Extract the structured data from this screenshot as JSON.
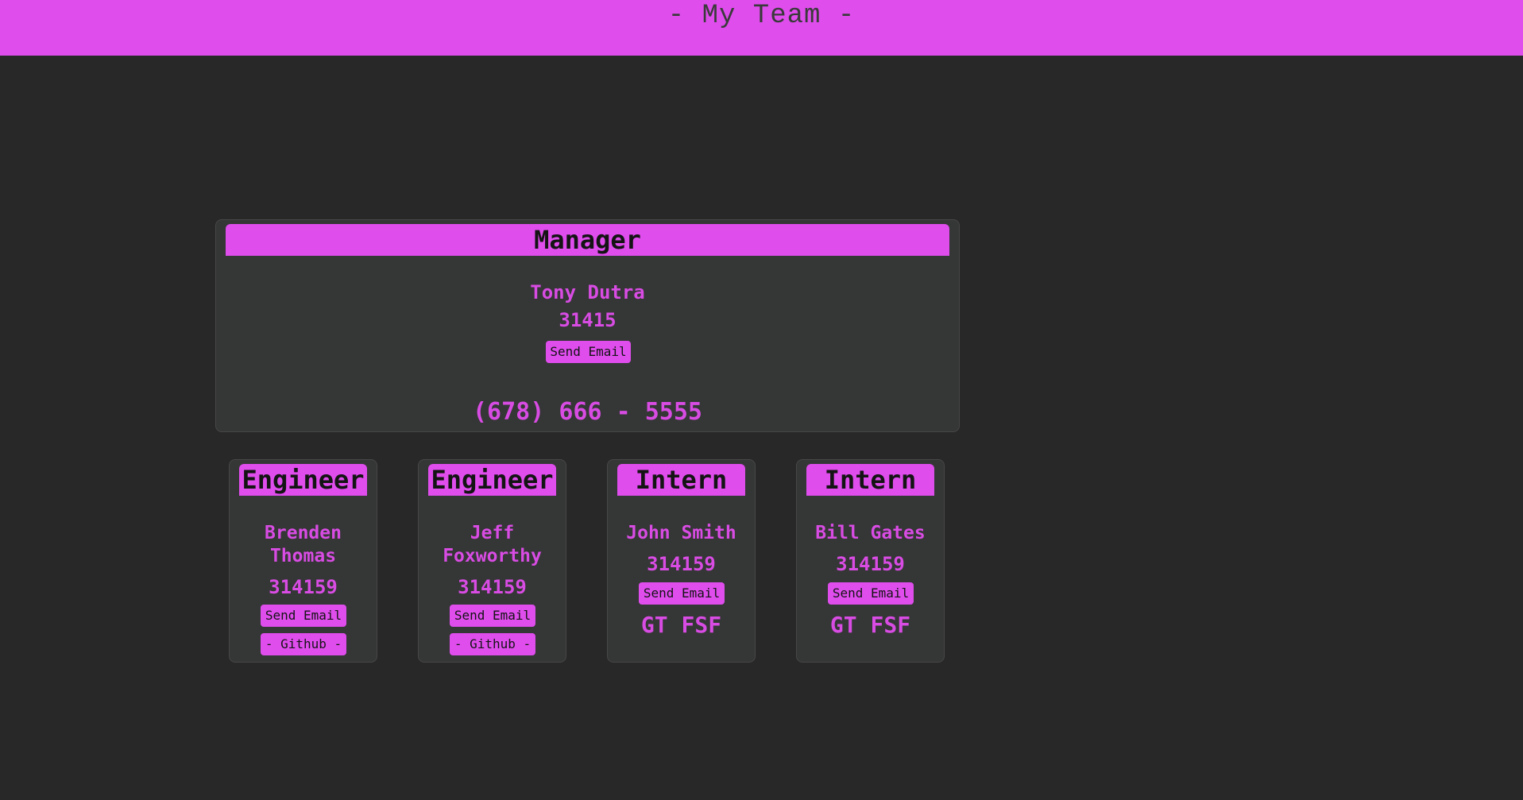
{
  "header": {
    "title": "- My Team -"
  },
  "colors": {
    "accent": "#df4ded",
    "background": "#282828",
    "card": "#353636",
    "text_accent": "#d84ce3"
  },
  "manager": {
    "role": "Manager",
    "name": "Tony Dutra",
    "id": "31415",
    "email_label": "Send Email",
    "office": "(678) 666 - 5555"
  },
  "employees": [
    {
      "role": "Engineer",
      "name": "Brenden Thomas",
      "id": "314159",
      "email_label": "Send Email",
      "github_label": "- Github -"
    },
    {
      "role": "Engineer",
      "name": "Jeff Foxworthy",
      "id": "314159",
      "email_label": "Send Email",
      "github_label": "- Github -"
    },
    {
      "role": "Intern",
      "name": "John Smith",
      "id": "314159",
      "email_label": "Send Email",
      "school": "GT FSF"
    },
    {
      "role": "Intern",
      "name": "Bill Gates",
      "id": "314159",
      "email_label": "Send Email",
      "school": "GT FSF"
    }
  ]
}
